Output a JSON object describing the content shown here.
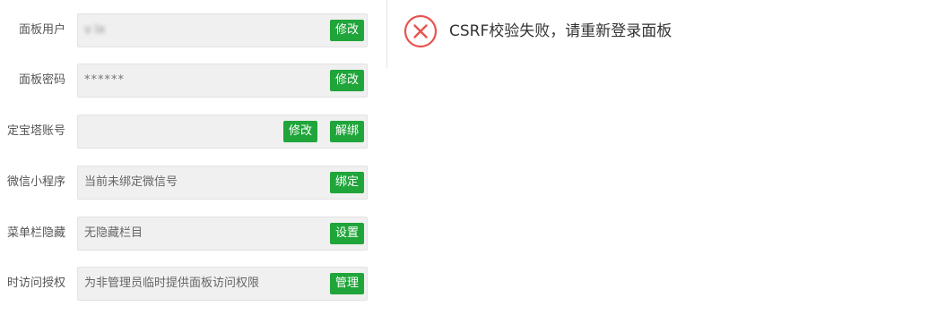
{
  "settings": {
    "rows": [
      {
        "label": "面板用户",
        "value": "v    lx",
        "buttons": [
          "修改"
        ]
      },
      {
        "label": "面板密码",
        "value": "******",
        "buttons": [
          "修改"
        ]
      },
      {
        "label": "定宝塔账号",
        "value": "",
        "buttons": [
          "修改",
          "解绑"
        ]
      },
      {
        "label": "微信小程序",
        "value": "当前未绑定微信号",
        "buttons": [
          "绑定"
        ]
      },
      {
        "label": "菜单栏隐藏",
        "value": "无隐藏栏目",
        "buttons": [
          "设置"
        ]
      },
      {
        "label": "时访问授权",
        "value": "为非管理员临时提供面板访问权限",
        "buttons": [
          "管理"
        ]
      }
    ]
  },
  "toast": {
    "icon": "error-x-icon",
    "message": "CSRF校验失败，请重新登录面板",
    "color": "#e8534f"
  },
  "colors": {
    "accent": "#20a53a"
  }
}
